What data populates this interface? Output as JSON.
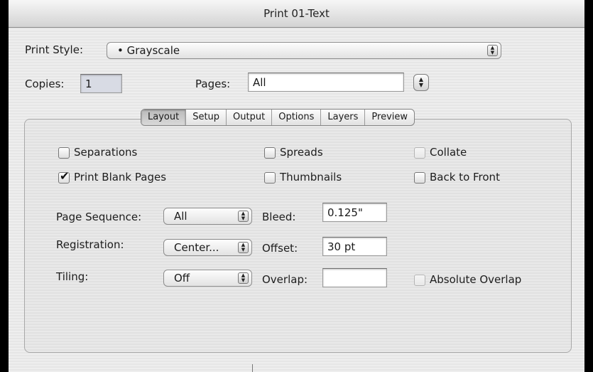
{
  "window": {
    "title": "Print 01-Text"
  },
  "print_style": {
    "label": "Print Style:",
    "value": "• Grayscale"
  },
  "copies": {
    "label": "Copies:",
    "value": "1"
  },
  "pages": {
    "label": "Pages:",
    "value": "All"
  },
  "tabs": [
    {
      "label": "Layout",
      "selected": true
    },
    {
      "label": "Setup",
      "selected": false
    },
    {
      "label": "Output",
      "selected": false
    },
    {
      "label": "Options",
      "selected": false
    },
    {
      "label": "Layers",
      "selected": false
    },
    {
      "label": "Preview",
      "selected": false
    }
  ],
  "checkboxes": {
    "separations": {
      "label": "Separations",
      "checked": false,
      "enabled": true
    },
    "spreads": {
      "label": "Spreads",
      "checked": false,
      "enabled": true
    },
    "collate": {
      "label": "Collate",
      "checked": false,
      "enabled": false
    },
    "print_blank_pages": {
      "label": "Print Blank Pages",
      "checked": true,
      "enabled": true
    },
    "thumbnails": {
      "label": "Thumbnails",
      "checked": false,
      "enabled": true
    },
    "back_to_front": {
      "label": "Back to Front",
      "checked": false,
      "enabled": true
    },
    "absolute_overlap": {
      "label": "Absolute Overlap",
      "checked": false,
      "enabled": false
    }
  },
  "page_sequence": {
    "label": "Page Sequence:",
    "value": "All"
  },
  "registration": {
    "label": "Registration:",
    "value": "Center..."
  },
  "tiling": {
    "label": "Tiling:",
    "value": "Off"
  },
  "bleed": {
    "label": "Bleed:",
    "value": "0.125\""
  },
  "offset": {
    "label": "Offset:",
    "value": "30 pt"
  },
  "overlap": {
    "label": "Overlap:",
    "value": ""
  },
  "glyphs": {
    "check": "✔",
    "stepper": "▲\n▼"
  }
}
